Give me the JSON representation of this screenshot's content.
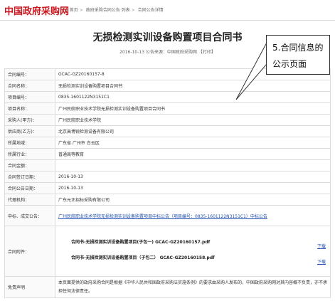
{
  "header": {
    "logo": "中国政府采购网",
    "breadcrumb": [
      "首页",
      "政府采购合同公告 列表",
      "合同公告详情"
    ]
  },
  "page": {
    "title": "无损检测实训设备购置项目合同书",
    "meta": "2016-10-13 公告来源：中国政府采购网 【打印】"
  },
  "callout": {
    "line1": "5.合同信息的",
    "line2": "公示页面"
  },
  "table": {
    "rows": [
      {
        "label": "合同编号：",
        "value": "GCAC-GZ20160157-8"
      },
      {
        "label": "合同名称：",
        "value": "无损检测实训设备购置项目合同书"
      },
      {
        "label": "项目编号：",
        "value": "0835-1601122N3151C1"
      },
      {
        "label": "项目名称：",
        "value": "广州民航职业技术学院无损检测实训设备购置项目合同书"
      },
      {
        "label": "采购人(甲方)：",
        "value": "广州民航职业技术学院"
      },
      {
        "label": "供应商(乙方)：",
        "value": "北京高博锐检测设备有限公司"
      },
      {
        "label": "所属地域：",
        "value": "广东省 广州市 白云区"
      },
      {
        "label": "所属行业：",
        "value": "普通高等教育"
      },
      {
        "label": "合同金额：",
        "value": ""
      },
      {
        "label": "合同签订日期：",
        "value": "2016-10-13"
      },
      {
        "label": "合同公告日期：",
        "value": "2016-10-13"
      },
      {
        "label": "代理机构：",
        "value": "广东元正招标采购有限公司"
      }
    ],
    "notice": {
      "label": "中标、成交公告：",
      "value": "广州民航职业技术学院无损检测实训设备购置项目中标公告（项目编号：0835-1601122N3151C1）中标公告"
    },
    "files": {
      "label": "合同附件：",
      "items": [
        {
          "name": "合同书-无损检测实训设备购置项目(子包一) GCAC-GZ20160157.pdf",
          "action": "下载"
        },
        {
          "name": "合同书-无损检测实训设备购置项目（子包二） GCAC-GZ20160158.pdf",
          "action": "下载"
        }
      ]
    },
    "disclaimer": {
      "label": "免责声明",
      "value": "本页面提供的政府采购合同是根据《中华人民共和国政府采购法实施条例》的要求由采购人发布的，中国政府采购网对其内容概不负责，亦不承担任何法律责任。"
    }
  }
}
